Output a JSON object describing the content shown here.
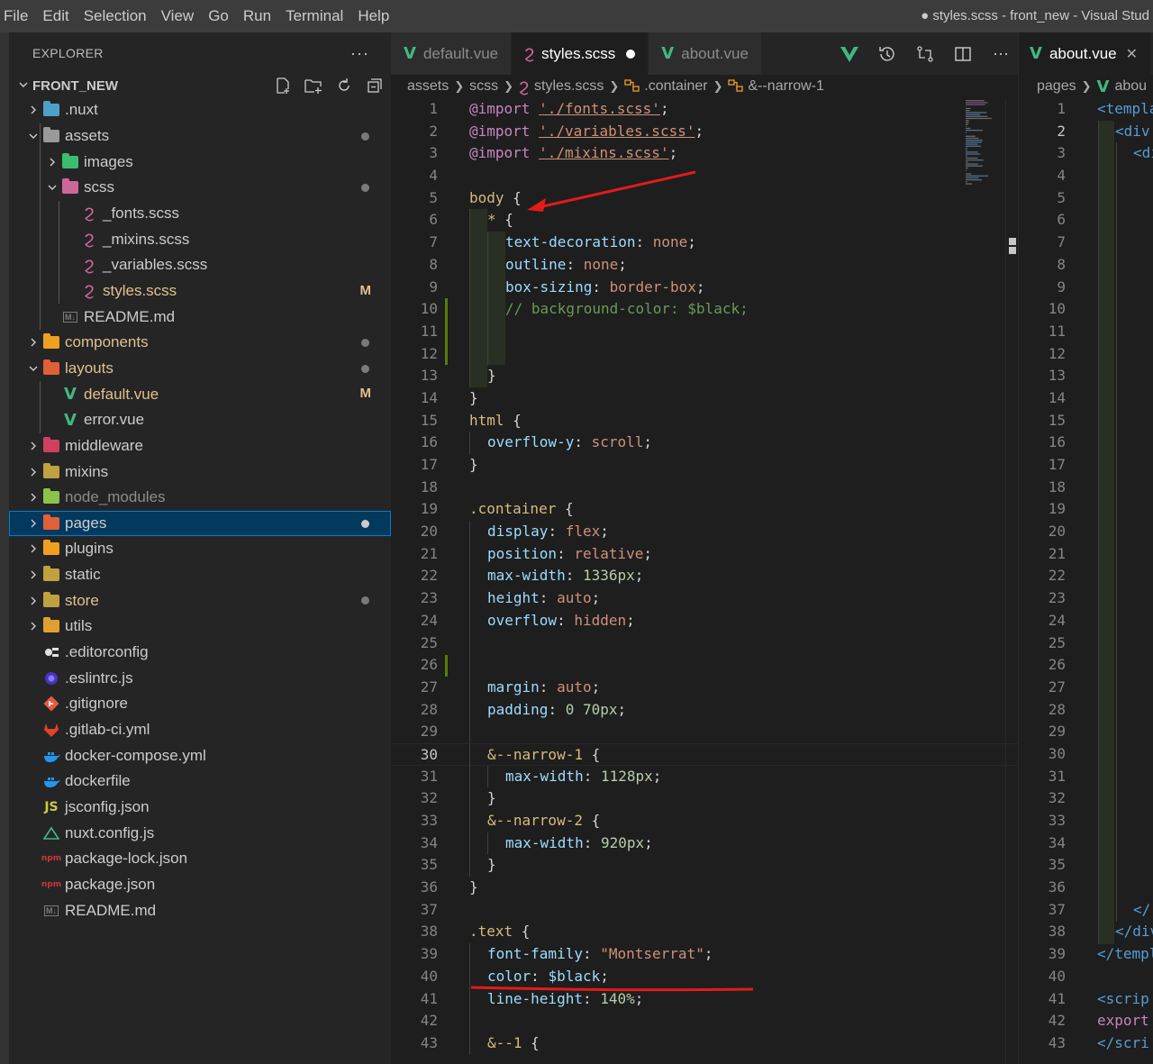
{
  "menu": [
    "File",
    "Edit",
    "Selection",
    "View",
    "Go",
    "Run",
    "Terminal",
    "Help"
  ],
  "window_title": "● styles.scss - front_new - Visual Stud",
  "explorer": {
    "title": "EXPLORER",
    "more": "···",
    "root": "FRONT_NEW",
    "items": [
      {
        "name": ".nuxt",
        "depth": 0,
        "kind": "folder",
        "open": false,
        "color": "#4fa0c8",
        "dim": false
      },
      {
        "name": "assets",
        "depth": 0,
        "kind": "folder",
        "open": true,
        "color": "#9a9a9a",
        "dot": true
      },
      {
        "name": "images",
        "depth": 1,
        "kind": "folder",
        "open": false,
        "color": "#3cbc6f"
      },
      {
        "name": "scss",
        "depth": 1,
        "kind": "folder",
        "open": true,
        "color": "#cd6799",
        "dot": true
      },
      {
        "name": "_fonts.scss",
        "depth": 2,
        "kind": "sass"
      },
      {
        "name": "_mixins.scss",
        "depth": 2,
        "kind": "sass"
      },
      {
        "name": "_variables.scss",
        "depth": 2,
        "kind": "sass"
      },
      {
        "name": "styles.scss",
        "depth": 2,
        "kind": "sass",
        "badge": "M",
        "mod": true
      },
      {
        "name": "README.md",
        "depth": 1,
        "kind": "md"
      },
      {
        "name": "components",
        "depth": 0,
        "kind": "folder",
        "open": false,
        "color": "#f0a020",
        "dot": true,
        "mod": true
      },
      {
        "name": "layouts",
        "depth": 0,
        "kind": "folder",
        "open": true,
        "color": "#e0603a",
        "dot": true,
        "mod": true
      },
      {
        "name": "default.vue",
        "depth": 1,
        "kind": "vue",
        "badge": "M",
        "mod": true
      },
      {
        "name": "error.vue",
        "depth": 1,
        "kind": "vue"
      },
      {
        "name": "middleware",
        "depth": 0,
        "kind": "folder",
        "open": false,
        "color": "#d04060"
      },
      {
        "name": "mixins",
        "depth": 0,
        "kind": "folder",
        "open": false,
        "color": "#c0a040"
      },
      {
        "name": "node_modules",
        "depth": 0,
        "kind": "folder",
        "open": false,
        "color": "#8bc34a",
        "dim": true
      },
      {
        "name": "pages",
        "depth": 0,
        "kind": "folder",
        "open": false,
        "color": "#e0603a",
        "dot": true,
        "selected": true
      },
      {
        "name": "plugins",
        "depth": 0,
        "kind": "folder",
        "open": false,
        "color": "#f0a020"
      },
      {
        "name": "static",
        "depth": 0,
        "kind": "folder",
        "open": false,
        "color": "#c0a040"
      },
      {
        "name": "store",
        "depth": 0,
        "kind": "folder",
        "open": false,
        "color": "#c0a040",
        "dot": true,
        "mod": true
      },
      {
        "name": "utils",
        "depth": 0,
        "kind": "folder",
        "open": false,
        "color": "#e0a030"
      },
      {
        "name": ".editorconfig",
        "depth": 0,
        "kind": "file",
        "icon": "editorconfig"
      },
      {
        "name": ".eslintrc.js",
        "depth": 0,
        "kind": "file",
        "icon": "eslint"
      },
      {
        "name": ".gitignore",
        "depth": 0,
        "kind": "file",
        "icon": "git"
      },
      {
        "name": ".gitlab-ci.yml",
        "depth": 0,
        "kind": "file",
        "icon": "gitlab"
      },
      {
        "name": "docker-compose.yml",
        "depth": 0,
        "kind": "file",
        "icon": "docker"
      },
      {
        "name": "dockerfile",
        "depth": 0,
        "kind": "file",
        "icon": "docker"
      },
      {
        "name": "jsconfig.json",
        "depth": 0,
        "kind": "file",
        "icon": "js"
      },
      {
        "name": "nuxt.config.js",
        "depth": 0,
        "kind": "file",
        "icon": "nuxt"
      },
      {
        "name": "package-lock.json",
        "depth": 0,
        "kind": "file",
        "icon": "npm"
      },
      {
        "name": "package.json",
        "depth": 0,
        "kind": "file",
        "icon": "npm"
      },
      {
        "name": "README.md",
        "depth": 0,
        "kind": "md"
      }
    ]
  },
  "editor1": {
    "tabs": [
      {
        "label": "default.vue",
        "active": false
      },
      {
        "label": "styles.scss",
        "active": true,
        "dirty": true
      },
      {
        "label": "about.vue",
        "active": false
      }
    ],
    "breadcrumb": [
      "assets",
      "scss",
      "styles.scss",
      ".container",
      "&--narrow-1"
    ],
    "current_line": 30,
    "lines": [
      [
        [
          "kw",
          "@import"
        ],
        [
          "t",
          " "
        ],
        [
          "str",
          "'./fonts.scss'"
        ],
        [
          "t",
          ";"
        ]
      ],
      [
        [
          "kw",
          "@import"
        ],
        [
          "t",
          " "
        ],
        [
          "str",
          "'./variables.scss'"
        ],
        [
          "t",
          ";"
        ]
      ],
      [
        [
          "kw",
          "@import"
        ],
        [
          "t",
          " "
        ],
        [
          "str",
          "'./mixins.scss'"
        ],
        [
          "t",
          ";"
        ]
      ],
      [],
      [
        [
          "sel",
          "body"
        ],
        [
          "t",
          " {"
        ]
      ],
      [
        [
          "i",
          1
        ],
        [
          "sel",
          "*"
        ],
        [
          "t",
          " {"
        ]
      ],
      [
        [
          "i",
          2
        ],
        [
          "prop",
          "text-decoration"
        ],
        [
          "t",
          ": "
        ],
        [
          "val",
          "none"
        ],
        [
          "t",
          ";"
        ]
      ],
      [
        [
          "i",
          2
        ],
        [
          "prop",
          "outline"
        ],
        [
          "t",
          ": "
        ],
        [
          "val",
          "none"
        ],
        [
          "t",
          ";"
        ]
      ],
      [
        [
          "i",
          2
        ],
        [
          "prop",
          "box-sizing"
        ],
        [
          "t",
          ": "
        ],
        [
          "val",
          "border-box"
        ],
        [
          "t",
          ";"
        ]
      ],
      [
        [
          "i",
          2
        ],
        [
          "cmt",
          "// background-color: $black;"
        ]
      ],
      [
        [
          "i",
          2
        ]
      ],
      [
        [
          "i",
          2
        ]
      ],
      [
        [
          "i",
          1
        ],
        [
          "t",
          "}"
        ]
      ],
      [
        [
          "t",
          "}"
        ]
      ],
      [
        [
          "sel",
          "html"
        ],
        [
          "t",
          " {"
        ]
      ],
      [
        [
          "i",
          1
        ],
        [
          "prop",
          "overflow-y"
        ],
        [
          "t",
          ": "
        ],
        [
          "val",
          "scroll"
        ],
        [
          "t",
          ";"
        ]
      ],
      [
        [
          "t",
          "}"
        ]
      ],
      [],
      [
        [
          "sel",
          ".container"
        ],
        [
          "t",
          " {"
        ]
      ],
      [
        [
          "i",
          1
        ],
        [
          "prop",
          "display"
        ],
        [
          "t",
          ": "
        ],
        [
          "val",
          "flex"
        ],
        [
          "t",
          ";"
        ]
      ],
      [
        [
          "i",
          1
        ],
        [
          "prop",
          "position"
        ],
        [
          "t",
          ": "
        ],
        [
          "val",
          "relative"
        ],
        [
          "t",
          ";"
        ]
      ],
      [
        [
          "i",
          1
        ],
        [
          "prop",
          "max-width"
        ],
        [
          "t",
          ": "
        ],
        [
          "num",
          "1336px"
        ],
        [
          "t",
          ";"
        ]
      ],
      [
        [
          "i",
          1
        ],
        [
          "prop",
          "height"
        ],
        [
          "t",
          ": "
        ],
        [
          "val",
          "auto"
        ],
        [
          "t",
          ";"
        ]
      ],
      [
        [
          "i",
          1
        ],
        [
          "prop",
          "overflow"
        ],
        [
          "t",
          ": "
        ],
        [
          "val",
          "hidden"
        ],
        [
          "t",
          ";"
        ]
      ],
      [
        [
          "i",
          1
        ]
      ],
      [
        [
          "i",
          1
        ]
      ],
      [
        [
          "i",
          1
        ],
        [
          "prop",
          "margin"
        ],
        [
          "t",
          ": "
        ],
        [
          "val",
          "auto"
        ],
        [
          "t",
          ";"
        ]
      ],
      [
        [
          "i",
          1
        ],
        [
          "prop",
          "padding"
        ],
        [
          "t",
          ": "
        ],
        [
          "num",
          "0 70px"
        ],
        [
          "t",
          ";"
        ]
      ],
      [
        [
          "i",
          1
        ]
      ],
      [
        [
          "i",
          1
        ],
        [
          "sel",
          "&--narrow-1"
        ],
        [
          "t",
          " {"
        ]
      ],
      [
        [
          "i",
          2
        ],
        [
          "prop",
          "max-width"
        ],
        [
          "t",
          ": "
        ],
        [
          "num",
          "1128px"
        ],
        [
          "t",
          ";"
        ]
      ],
      [
        [
          "i",
          1
        ],
        [
          "t",
          "}"
        ]
      ],
      [
        [
          "i",
          1
        ],
        [
          "sel",
          "&--narrow-2"
        ],
        [
          "t",
          " {"
        ]
      ],
      [
        [
          "i",
          2
        ],
        [
          "prop",
          "max-width"
        ],
        [
          "t",
          ": "
        ],
        [
          "num",
          "920px"
        ],
        [
          "t",
          ";"
        ]
      ],
      [
        [
          "i",
          1
        ],
        [
          "t",
          "}"
        ]
      ],
      [
        [
          "t",
          "}"
        ]
      ],
      [],
      [
        [
          "sel",
          ".text"
        ],
        [
          "t",
          " {"
        ]
      ],
      [
        [
          "i",
          1
        ],
        [
          "prop",
          "font-family"
        ],
        [
          "t",
          ": "
        ],
        [
          "val",
          "\"Montserrat\""
        ],
        [
          "t",
          ";"
        ]
      ],
      [
        [
          "i",
          1
        ],
        [
          "prop",
          "color"
        ],
        [
          "t",
          ": "
        ],
        [
          "var",
          "$black"
        ],
        [
          "t",
          ";"
        ]
      ],
      [
        [
          "i",
          1
        ],
        [
          "prop",
          "line-height"
        ],
        [
          "t",
          ": "
        ],
        [
          "num",
          "140%"
        ],
        [
          "t",
          ";"
        ]
      ],
      [
        [
          "i",
          1
        ]
      ],
      [
        [
          "i",
          1
        ],
        [
          "sel",
          "&--1"
        ],
        [
          "t",
          " {"
        ]
      ]
    ]
  },
  "editor2": {
    "tab": "about.vue",
    "close": "✕",
    "breadcrumb": [
      "pages",
      "abou"
    ],
    "current_line": 2,
    "lines": [
      "<templa",
      "<div",
      "<di",
      "",
      "",
      "",
      "",
      "",
      "",
      "",
      "",
      "",
      "",
      "",
      "",
      "",
      "",
      "",
      "",
      "",
      "",
      "",
      "",
      "",
      "",
      "",
      "",
      "",
      "",
      "",
      "",
      "",
      "",
      "",
      "",
      "",
      "</",
      "</div",
      "</templ",
      "",
      "<scrip",
      "export",
      "</scri"
    ]
  },
  "colors": {
    "accent": "#007fd4",
    "annotation": "#e21b1b",
    "git_added": "#587c0c",
    "vue": "#41b883",
    "sass": "#cd6799"
  }
}
